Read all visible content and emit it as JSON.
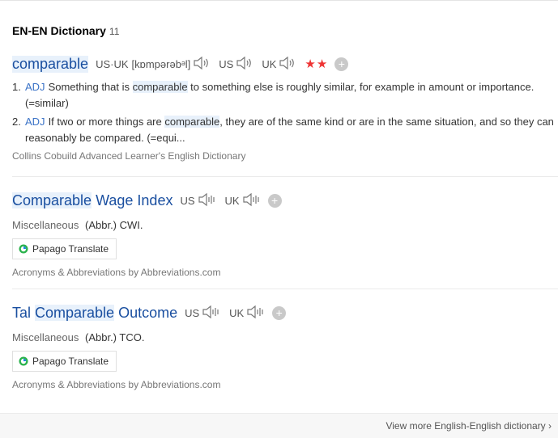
{
  "header": {
    "title": "EN-EN Dictionary",
    "count": "11"
  },
  "entry1": {
    "headword": "comparable",
    "pron_label": "US·UK",
    "phonetic": "[kɒmpərəbᵊl]",
    "us_label": "US",
    "uk_label": "UK",
    "stars": "★★",
    "senses": [
      {
        "num": "1.",
        "pos": "ADJ",
        "pre": "Something that is ",
        "hl": "comparable",
        "post": " to something else is roughly similar, for example in amount or importance. (=similar)"
      },
      {
        "num": "2.",
        "pos": "ADJ",
        "pre": "If two or more things are ",
        "hl": "comparable",
        "post": ", they are of the same kind or are in the same situation, and so they can reasonably be compared. (=equi..."
      }
    ],
    "source": "Collins Cobuild Advanced Learner's English Dictionary"
  },
  "entry2": {
    "headword_hl": "Comparable",
    "headword_rest": " Wage Index",
    "us_label": "US",
    "uk_label": "UK",
    "category": "Miscellaneous",
    "definition": "(Abbr.) CWI.",
    "papago": "Papago Translate",
    "source": "Acronyms & Abbreviations by Abbreviations.com"
  },
  "entry3": {
    "headword_pre": "Tal ",
    "headword_hl": "Comparable",
    "headword_rest": " Outcome",
    "us_label": "US",
    "uk_label": "UK",
    "category": "Miscellaneous",
    "definition": "(Abbr.) TCO.",
    "papago": "Papago Translate",
    "source": "Acronyms & Abbreviations by Abbreviations.com"
  },
  "footer": {
    "more_link": "View more English-English dictionary",
    "chevron": "›"
  },
  "icons": {
    "speaker": "speaker-icon",
    "plus": "+",
    "papago": "papago-logo-icon"
  },
  "colors": {
    "headword": "#1a4fa0",
    "pos": "#3b73c7",
    "highlight": "#e8f1fb",
    "stars": "#ee3333"
  }
}
